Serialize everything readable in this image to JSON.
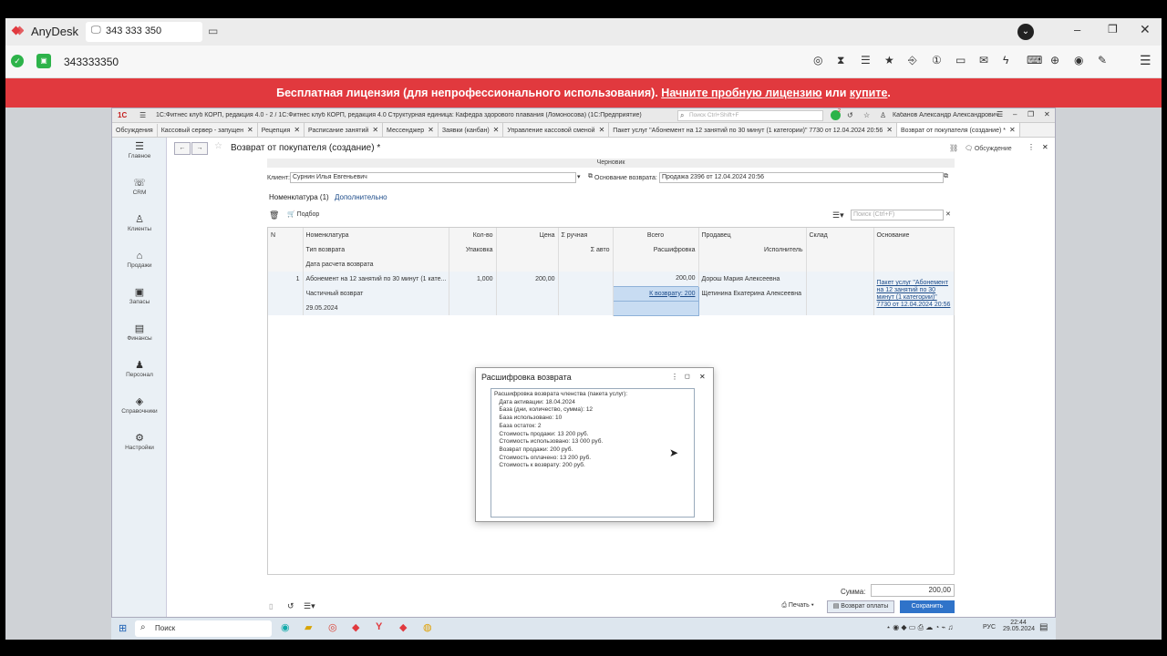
{
  "anydesk": {
    "app_name": "AnyDesk",
    "session_id": "343 333 350",
    "address": "343333350",
    "banner_text": "Бесплатная лицензия (для непрофессионального использования).",
    "banner_link1": "Начните пробную лицензию",
    "banner_or": "или",
    "banner_link2": "купите"
  },
  "window": {
    "title": "1С:Фитнес клуб КОРП, редакция 4.0 - 2 / 1С:Фитнес клуб КОРП, редакция 4.0 Структурная единица: Кафедра здорового плавания (Ломоносова)  (1С:Предприятие)",
    "search_placeholder": "Поиск Ctrl+Shift+F",
    "user": "Кабанов Александр Александрович",
    "badge": "2"
  },
  "tabs": [
    {
      "label": "Обсуждения"
    },
    {
      "label": "Кассовый сервер - запущен"
    },
    {
      "label": "Рецепция"
    },
    {
      "label": "Расписание занятий"
    },
    {
      "label": "Мессенджер"
    },
    {
      "label": "Заявки (канбан)"
    },
    {
      "label": "Управление кассовой сменой"
    },
    {
      "label": "Пакет услуг \"Абонемент на 12 занятий по 30 минут (1 категории)\" 7730 от 12.04.2024 20:56"
    },
    {
      "label": "Возврат от покупателя (создание) *"
    }
  ],
  "sidebar": [
    {
      "label": "Главное",
      "icon": "menu-icon"
    },
    {
      "label": "CRM",
      "icon": "crm-icon"
    },
    {
      "label": "Клиенты",
      "icon": "clients-icon"
    },
    {
      "label": "Продажи",
      "icon": "sales-icon"
    },
    {
      "label": "Запасы",
      "icon": "stock-icon"
    },
    {
      "label": "Финансы",
      "icon": "finance-icon"
    },
    {
      "label": "Персонал",
      "icon": "staff-icon"
    },
    {
      "label": "Справочники",
      "icon": "catalogs-icon"
    },
    {
      "label": "Настройки",
      "icon": "settings-icon"
    }
  ],
  "doc": {
    "title": "Возврат от покупателя (создание) *",
    "discussion": "Обсуждение",
    "status": "Черновик",
    "client_label": "Клиент:",
    "client_value": "Сурнин Илья Евгеньевич",
    "reason_label": "Основание возврата:",
    "reason_value": "Продажа 2396 от 12.04.2024 20:56",
    "tab_items": "Номенклатура (1)",
    "tab_extra": "Дополнительно",
    "pick_label": "Подбор",
    "search_placeholder": "Поиск (Ctrl+F)",
    "total_label": "Сумма:",
    "total_value": "200,00",
    "print_label": "Печать",
    "refund_label": "Возврат оплаты",
    "save_label": "Сохранить"
  },
  "table": {
    "headers": {
      "n": "N",
      "nom": "Номенклатура",
      "type": "Тип возврата",
      "date": "Дата расчета возврата",
      "qty": "Кол-во",
      "pack": "Упаковка",
      "price": "Цена",
      "manual": "Σ ручная",
      "auto": "Σ авто",
      "total": "Всего",
      "breakdown": "Расшифровка",
      "seller": "Продавец",
      "executor": "Исполнитель",
      "warehouse": "Склад",
      "basis": "Основание"
    },
    "row": {
      "n": "1",
      "nom": "Абонемент на 12 занятий по 30 минут (1 кате...",
      "type": "Частичный возврат",
      "date": "29.05.2024",
      "qty": "1,000",
      "price": "200,00",
      "total": "200,00",
      "breakdown": "К возврату: 200",
      "seller": "Дорош Мария Алексеевна",
      "executor": "Щетинина Екатерина Алексеевна",
      "basis1": "Пакет услуг \"Абонемент",
      "basis2": "на 12 занятий по 30",
      "basis3": "минут (1 категории)\"",
      "basis4": "7730 от 12.04.2024 20:56"
    }
  },
  "dialog": {
    "title": "Расшифровка возврата",
    "lines": [
      "Расшифровка возврата членства (пакета услуг):",
      "   Дата активации: 18.04.2024",
      "   База (дни, количество, сумма): 12",
      "   База использовано: 10",
      "   База остаток: 2",
      "   Стоимость продажи: 13 200 руб.",
      "   Стоимость использовано: 13 000 руб.",
      "   Возврат продажи: 200 руб.",
      "   Стоимость оплачено: 13 200 руб.",
      "   Стоимость к возврату: 200 руб."
    ]
  },
  "taskbar": {
    "search_label": "Поиск",
    "lang": "РУС",
    "time": "22:44",
    "date": "29.05.2024"
  },
  "colors": {
    "banner": "#e1393e",
    "primary_button": "#2f73c9"
  }
}
